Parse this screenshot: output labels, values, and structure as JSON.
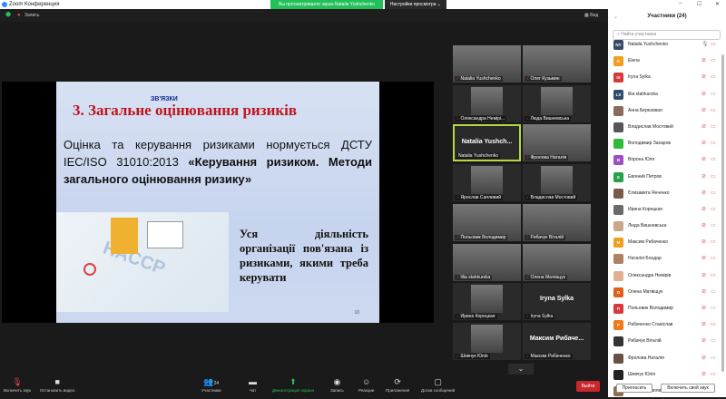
{
  "window": {
    "title": "Zoom Конференция",
    "banner": "Вы просматриваете экран Natalia Yushchenko",
    "view_options": "Настройки просмотра ⌄",
    "minimize": "–",
    "maximize": "☐",
    "close": "✕"
  },
  "topbar": {
    "record": "Запись",
    "view": "Вид"
  },
  "slide": {
    "header_fragment": "ЗВ'ЯЗКИ",
    "title": "3. Загальне оцінювання ризиків",
    "para1_a": "Оцінка та керування ризиками нормується ДСТУ IEC/ISO 31010:2013 ",
    "para1_b": "«Керування ризиком. Методи загального оцінювання ризику»",
    "para2": "Уся діяльність організації пов'язана із ризиками, якими треба керувати",
    "page": "10",
    "image_label": "HACCP"
  },
  "gallery": [
    {
      "name": "Natalia Yushchenko",
      "type": "video"
    },
    {
      "name": "Олег Кузьмин",
      "type": "video"
    },
    {
      "name": "Олександра Немірі...",
      "type": "photo"
    },
    {
      "name": "Люда Вишневська",
      "type": "photo"
    },
    {
      "name": "Natalia Yushchenko",
      "type": "name",
      "big": "Natalia  Yushch..."
    },
    {
      "name": "Фролова Наталія",
      "type": "video"
    },
    {
      "name": "Ярослав Сапливий",
      "type": "photo"
    },
    {
      "name": "Владислав Мостовий",
      "type": "photo"
    },
    {
      "name": "Польовик Володимир",
      "type": "video"
    },
    {
      "name": "Рибачук Віталій",
      "type": "video"
    },
    {
      "name": "lilia stahkurska",
      "type": "video"
    },
    {
      "name": "Олена Матвіщук",
      "type": "video"
    },
    {
      "name": "Ирина Корецкая",
      "type": "photo"
    },
    {
      "name": "Iryna Sylka",
      "type": "name",
      "big": "Iryna Sylka"
    },
    {
      "name": "Шевчук Юлія",
      "type": "photo"
    },
    {
      "name": "Максим Рибаченко",
      "type": "name",
      "big": "Максим  Рибаче..."
    }
  ],
  "toolbar": {
    "unmute": "Включить звук",
    "video": "Остановить видео",
    "participants": "Участники",
    "participants_count": "24",
    "chat": "Чат",
    "share": "Демонстрация экрана",
    "record": "Запись",
    "reactions": "Реакции",
    "apps": "Приложения",
    "whiteboard": "Доски сообщений",
    "leave": "Выйти"
  },
  "panel": {
    "title": "Участники (24)",
    "search_placeholder": "Найти участника",
    "invite": "Пригласить",
    "unmute_self": "Включить свой звук",
    "participants": [
      {
        "name": "Natalia Yushchenko",
        "initials": "NY",
        "color": "#3a4a66",
        "cam_on": false
      },
      {
        "name": "Elena",
        "initials": "E",
        "color": "#f29d1b",
        "cam_on": false
      },
      {
        "name": "Iryna Sylka",
        "initials": "IS",
        "color": "#d6393a",
        "cam_on": false
      },
      {
        "name": "lilia stahkurska",
        "initials": "LS",
        "color": "#2f4a6b",
        "cam_on": true
      },
      {
        "name": "Анна Березовая",
        "initials": "",
        "color": "#8a6a5a",
        "cam_on": false
      },
      {
        "name": "Владислав Мостовий",
        "initials": "",
        "color": "#555",
        "cam_on": false
      },
      {
        "name": "Володимир Захаров",
        "initials": "",
        "color": "#2dbb3a",
        "cam_on": false
      },
      {
        "name": "Ворона Юля",
        "initials": "В",
        "color": "#9b4fc8",
        "cam_on": false
      },
      {
        "name": "Евгений Петров",
        "initials": "Є",
        "color": "#27a04a",
        "cam_on": false
      },
      {
        "name": "Єлизавета Янченко",
        "initials": "",
        "color": "#7a5a4a",
        "cam_on": false
      },
      {
        "name": "Ирина Корецкая",
        "initials": "",
        "color": "#6a6a6a",
        "cam_on": false
      },
      {
        "name": "Люда Вишневська",
        "initials": "",
        "color": "#c9a88a",
        "cam_on": true
      },
      {
        "name": "Максим Рибаченко",
        "initials": "М",
        "color": "#f29d1b",
        "cam_on": false
      },
      {
        "name": "Наталія Бондар",
        "initials": "",
        "color": "#b08060",
        "cam_on": false
      },
      {
        "name": "Олександра Немірів",
        "initials": "",
        "color": "#e0b090",
        "cam_on": false
      },
      {
        "name": "Олена Матвіщук",
        "initials": "О",
        "color": "#e0601b",
        "cam_on": true
      },
      {
        "name": "Польовик Володимир",
        "initials": "П",
        "color": "#d6393a",
        "cam_on": true
      },
      {
        "name": "Рибаченко Станіслав",
        "initials": "Р",
        "color": "#f07a1b",
        "cam_on": false
      },
      {
        "name": "Рибачук Віталій",
        "initials": "",
        "color": "#333",
        "cam_on": true
      },
      {
        "name": "Фролова Наталія",
        "initials": "",
        "color": "#6a5040",
        "cam_on": true
      },
      {
        "name": "Шевчук Юлія",
        "initials": "",
        "color": "#222",
        "cam_on": false
      },
      {
        "name": "Ярослав Сапливий",
        "initials": "",
        "color": "#8a7050",
        "cam_on": false
      }
    ]
  }
}
